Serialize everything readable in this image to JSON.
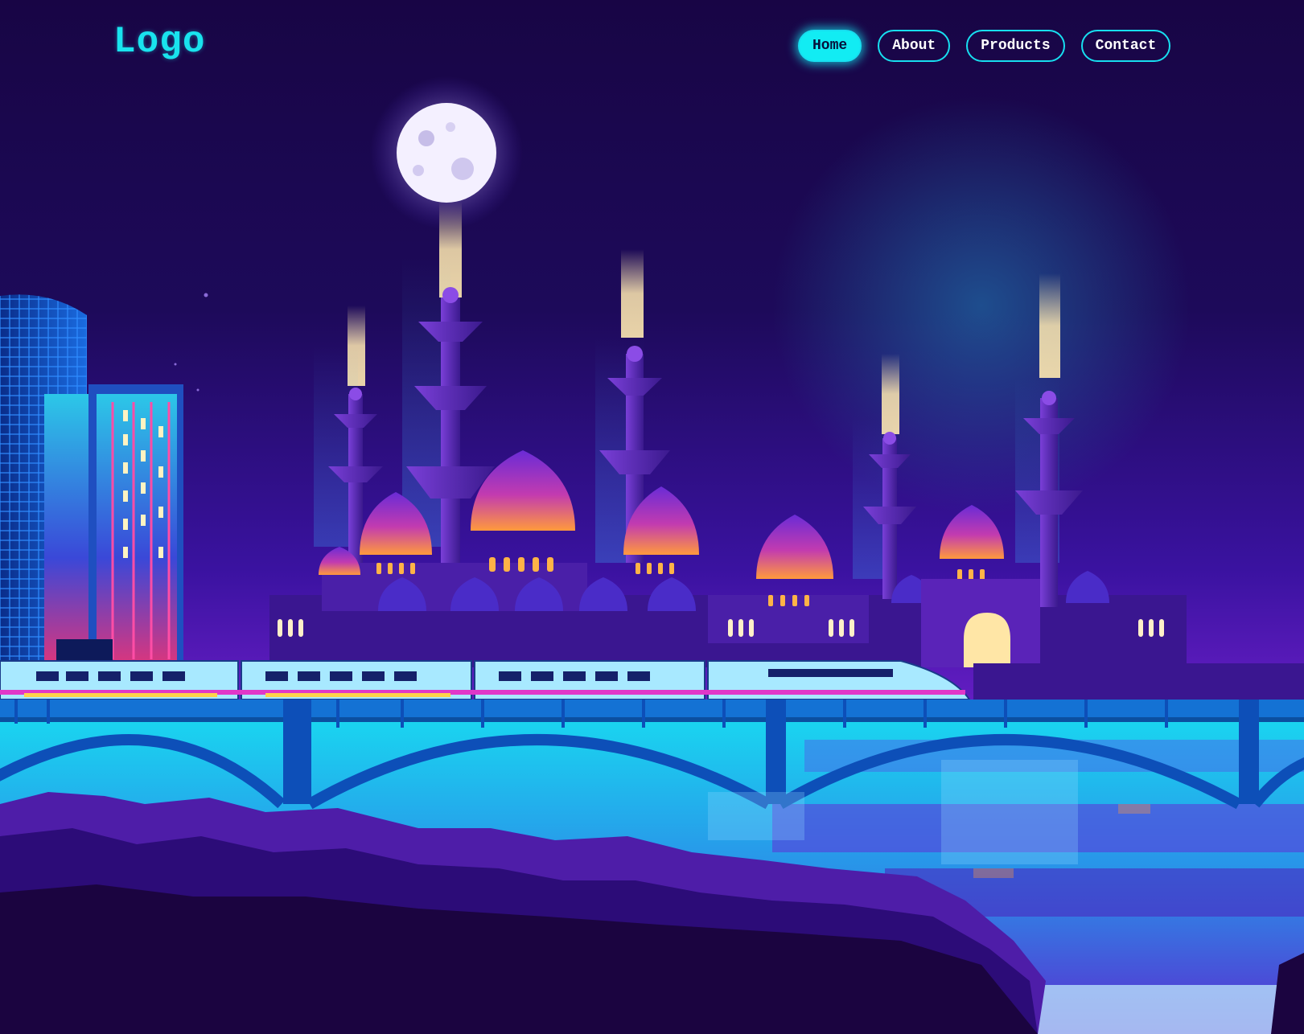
{
  "header": {
    "logo_text": "Logo",
    "nav": [
      {
        "label": "Home",
        "active": true
      },
      {
        "label": "About",
        "active": false
      },
      {
        "label": "Products",
        "active": false
      },
      {
        "label": "Contact",
        "active": false
      }
    ]
  },
  "theme": {
    "accent": "#12ecf3",
    "background": "#1a0440",
    "nav_text": "#ffffff"
  },
  "hero": {
    "illustration": "night-city-mosque-train-bridge"
  }
}
